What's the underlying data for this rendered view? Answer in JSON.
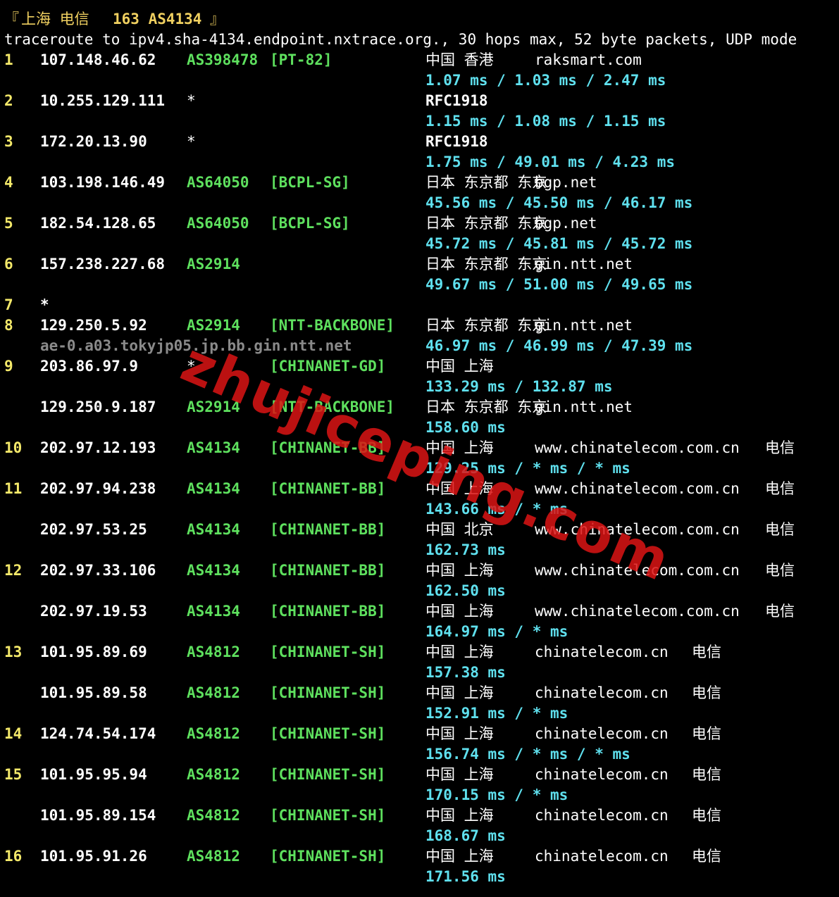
{
  "header": {
    "open_bracket": "『",
    "location": "上海 电信",
    "target_label": "163 AS4134",
    "close_bracket": "』"
  },
  "command_line": "traceroute to ipv4.sha-4134.endpoint.nxtrace.org., 30 hops max, 52 byte packets, UDP mode",
  "hops": [
    {
      "hop": "1",
      "ip": "107.148.46.62",
      "asn": "AS398478",
      "net": "[PT-82]",
      "geo": "中国 香港",
      "domain": "raksmart.com",
      "isp": "",
      "rtt": "1.07 ms / 1.03 ms / 2.47 ms"
    },
    {
      "hop": "2",
      "ip": "10.255.129.111",
      "asn": "*",
      "net": "",
      "geo": "RFC1918",
      "domain": "",
      "isp": "",
      "rtt": "1.15 ms / 1.08 ms / 1.15 ms"
    },
    {
      "hop": "3",
      "ip": "172.20.13.90",
      "asn": "*",
      "net": "",
      "geo": "RFC1918",
      "domain": "",
      "isp": "",
      "rtt": "1.75 ms / 49.01 ms / 4.23 ms"
    },
    {
      "hop": "4",
      "ip": "103.198.146.49",
      "asn": "AS64050",
      "net": "[BCPL-SG]",
      "geo": "日本 东京都 东京",
      "domain": "bgp.net",
      "isp": "",
      "rtt": "45.56 ms / 45.50 ms / 46.17 ms"
    },
    {
      "hop": "5",
      "ip": "182.54.128.65",
      "asn": "AS64050",
      "net": "[BCPL-SG]",
      "geo": "日本 东京都 东京",
      "domain": "bgp.net",
      "isp": "",
      "rtt": "45.72 ms / 45.81 ms / 45.72 ms"
    },
    {
      "hop": "6",
      "ip": "157.238.227.68",
      "asn": "AS2914",
      "net": "",
      "geo": "日本 东京都 东京",
      "domain": "gin.ntt.net",
      "isp": "",
      "rtt": "49.67 ms / 51.00 ms / 49.65 ms"
    },
    {
      "hop": "7",
      "ip": "*",
      "asn": "",
      "net": "",
      "geo": "",
      "domain": "",
      "isp": "",
      "rtt": ""
    },
    {
      "hop": "8",
      "ip": "129.250.5.92",
      "asn": "AS2914",
      "net": "[NTT-BACKBONE]",
      "geo": "日本 东京都 东京",
      "domain": "gin.ntt.net",
      "isp": "",
      "rtt": "46.97 ms / 46.99 ms / 47.39 ms",
      "hostname": "ae-0.a03.tokyjp05.jp.bb.gin.ntt.net"
    },
    {
      "hop": "9",
      "ip": "203.86.97.9",
      "asn": "*",
      "net": "[CHINANET-GD]",
      "geo": "中国 上海",
      "domain": "",
      "isp": "",
      "rtt": "133.29 ms / 132.87 ms"
    },
    {
      "hop": "",
      "ip": "129.250.9.187",
      "asn": "AS2914",
      "net": "[NTT-BACKBONE]",
      "geo": "日本 东京都 东京",
      "domain": "gin.ntt.net",
      "isp": "",
      "rtt": "158.60 ms"
    },
    {
      "hop": "10",
      "ip": "202.97.12.193",
      "asn": "AS4134",
      "net": "[CHINANET-BB]",
      "geo": "中国 上海",
      "domain": "www.chinatelecom.com.cn",
      "isp": "电信",
      "rtt": "129.25 ms / * ms / * ms"
    },
    {
      "hop": "11",
      "ip": "202.97.94.238",
      "asn": "AS4134",
      "net": "[CHINANET-BB]",
      "geo": "中国 上海",
      "domain": "www.chinatelecom.com.cn",
      "isp": "电信",
      "rtt": "143.66 ms / * ms"
    },
    {
      "hop": "",
      "ip": "202.97.53.25",
      "asn": "AS4134",
      "net": "[CHINANET-BB]",
      "geo": "中国 北京",
      "domain": "www.chinatelecom.com.cn",
      "isp": "电信",
      "rtt": "162.73 ms"
    },
    {
      "hop": "12",
      "ip": "202.97.33.106",
      "asn": "AS4134",
      "net": "[CHINANET-BB]",
      "geo": "中国 上海",
      "domain": "www.chinatelecom.com.cn",
      "isp": "电信",
      "rtt": "162.50 ms"
    },
    {
      "hop": "",
      "ip": "202.97.19.53",
      "asn": "AS4134",
      "net": "[CHINANET-BB]",
      "geo": "中国 上海",
      "domain": "www.chinatelecom.com.cn",
      "isp": "电信",
      "rtt": "164.97 ms / * ms"
    },
    {
      "hop": "13",
      "ip": "101.95.89.69",
      "asn": "AS4812",
      "net": "[CHINANET-SH]",
      "geo": "中国 上海",
      "domain": "chinatelecom.cn",
      "isp": "电信",
      "rtt": "157.38 ms"
    },
    {
      "hop": "",
      "ip": "101.95.89.58",
      "asn": "AS4812",
      "net": "[CHINANET-SH]",
      "geo": "中国 上海",
      "domain": "chinatelecom.cn",
      "isp": "电信",
      "rtt": "152.91 ms / * ms"
    },
    {
      "hop": "14",
      "ip": "124.74.54.174",
      "asn": "AS4812",
      "net": "[CHINANET-SH]",
      "geo": "中国 上海",
      "domain": "chinatelecom.cn",
      "isp": "电信",
      "rtt": "156.74 ms / * ms / * ms"
    },
    {
      "hop": "15",
      "ip": "101.95.95.94",
      "asn": "AS4812",
      "net": "[CHINANET-SH]",
      "geo": "中国 上海",
      "domain": "chinatelecom.cn",
      "isp": "电信",
      "rtt": "170.15 ms / * ms"
    },
    {
      "hop": "",
      "ip": "101.95.89.154",
      "asn": "AS4812",
      "net": "[CHINANET-SH]",
      "geo": "中国 上海",
      "domain": "chinatelecom.cn",
      "isp": "电信",
      "rtt": "168.67 ms"
    },
    {
      "hop": "16",
      "ip": "101.95.91.26",
      "asn": "AS4812",
      "net": "[CHINANET-SH]",
      "geo": "中国 上海",
      "domain": "chinatelecom.cn",
      "isp": "电信",
      "rtt": "171.56 ms"
    }
  ],
  "watermark": "zhujiceping.com",
  "colors": {
    "hop_number": "#f4e96a",
    "ip": "#ffffff",
    "asn": "#5ee05e",
    "rtt": "#5fe0ee",
    "hostname": "#8a8a8a",
    "watermark": "#dc1414",
    "background": "#000000"
  }
}
